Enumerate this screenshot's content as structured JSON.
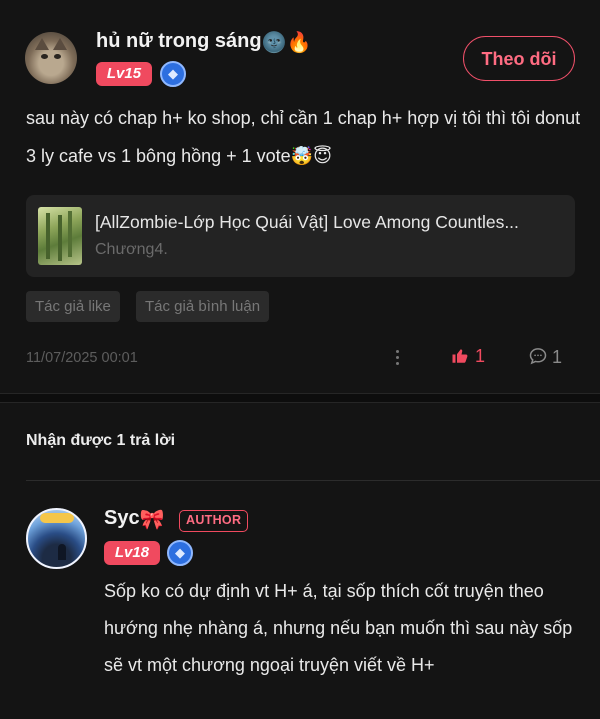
{
  "comment": {
    "username": "hủ nữ trong sáng",
    "name_emojis": "🌚🔥",
    "level": "Lv15",
    "follow_label": "Theo dõi",
    "text": "sau này có chap h+ ko shop, chỉ cần 1 chap h+ hợp vị tôi thì tôi donut 3 ly cafe vs 1 bông hồng + 1 vote🤯😇",
    "book": {
      "title": "[AllZombie-Lớp Học Quái Vật] Love Among Countles...",
      "chapter": "Chương4."
    },
    "tags": [
      "Tác giả like",
      "Tác giả bình luận"
    ],
    "date": "11/07/2025 00:01",
    "likes": "1",
    "comments": "1"
  },
  "replies": {
    "title": "Nhận được 1 trả lời",
    "items": [
      {
        "username": "Syc",
        "name_emoji": "🎀",
        "author_badge": "AUTHOR",
        "level": "Lv18",
        "text": "Sốp ko có dự định vt H+ á, tại sốp thích cốt truyện theo hướng nhẹ nhàng á, nhưng nếu bạn muốn thì sau này sốp sẽ vt một chương ngoại truyện viết về H+"
      }
    ]
  },
  "icons": {
    "vip_badge": "diamond-badge-icon",
    "more": "more-vertical-icon",
    "like": "thumbs-up-icon",
    "comment": "comment-bubble-icon"
  },
  "colors": {
    "accent": "#f04a5f",
    "background": "#141414",
    "card": "#232323"
  }
}
